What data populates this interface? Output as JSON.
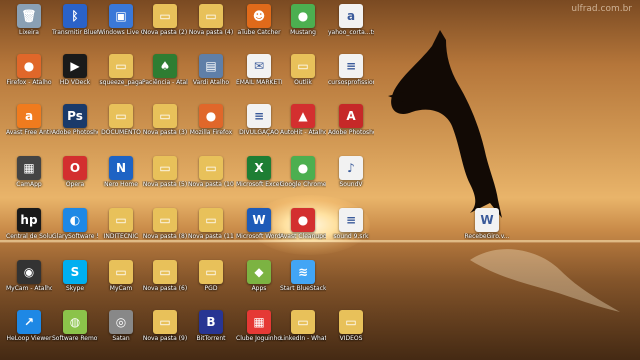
{
  "watermark": "ulfrad.com.br",
  "desktop_icons": [
    {
      "label": "Lixeira",
      "icon": "recycle-bin-icon",
      "color": "#8aa0b4",
      "glyph": "🗑"
    },
    {
      "label": "Transmitir Bluetooth",
      "icon": "bluetooth-icon",
      "color": "#2a62c8",
      "glyph": "ᛒ"
    },
    {
      "label": "Windows Live Galeria de Fotos",
      "icon": "photo-gallery-icon",
      "color": "#3a78d8",
      "glyph": "▣"
    },
    {
      "label": "Nova pasta (2)",
      "icon": "folder-icon",
      "color": "#e8c15a",
      "glyph": "▭"
    },
    {
      "label": "Nova pasta (4)",
      "icon": "folder-icon",
      "color": "#e8c15a",
      "glyph": "▭"
    },
    {
      "label": "aTube Catcher",
      "icon": "atube-icon",
      "color": "#e06a1a",
      "glyph": "☻"
    },
    {
      "label": "Mustang",
      "icon": "chrome-app-icon",
      "color": "#4caf50",
      "glyph": "●"
    },
    {
      "label": "yahoo_corta...ts Atalho",
      "icon": "document-icon",
      "color": "#f2f2f2",
      "glyph": "a"
    },
    {
      "label": "Firefox - Atalho",
      "icon": "firefox-icon",
      "color": "#e0672a",
      "glyph": "●"
    },
    {
      "label": "HD VDeck",
      "icon": "hd-vdeck-icon",
      "color": "#1a1a1a",
      "glyph": "▶"
    },
    {
      "label": "squeeze_paga",
      "icon": "folder-icon",
      "color": "#e8c15a",
      "glyph": "▭"
    },
    {
      "label": "Paciência - Atalho",
      "icon": "solitaire-icon",
      "color": "#2e7d32",
      "glyph": "♠"
    },
    {
      "label": "Vardi Atalho",
      "icon": "computer-icon",
      "color": "#5f7fa8",
      "glyph": "▤"
    },
    {
      "label": "EMAIL MARKETING",
      "icon": "document-icon",
      "color": "#f2f2f2",
      "glyph": "✉"
    },
    {
      "label": "Outlik",
      "icon": "folder-icon",
      "color": "#e8c15a",
      "glyph": "▭"
    },
    {
      "label": "cursosprofissionais (1) - Atalho",
      "icon": "document-icon",
      "color": "#f2f2f2",
      "glyph": "≡"
    },
    {
      "label": "Avast Free Antivirus",
      "icon": "avast-icon",
      "color": "#f07b1e",
      "glyph": "a"
    },
    {
      "label": "Adobe Photoshop ...",
      "icon": "photoshop-icon",
      "color": "#1a3a6a",
      "glyph": "Ps"
    },
    {
      "label": "DOCUMENTO",
      "icon": "folder-icon",
      "color": "#e8c15a",
      "glyph": "▭"
    },
    {
      "label": "Nova pasta (3)",
      "icon": "folder-icon",
      "color": "#e8c15a",
      "glyph": "▭"
    },
    {
      "label": "Mozilla Firefox",
      "icon": "firefox-icon",
      "color": "#e0672a",
      "glyph": "●"
    },
    {
      "label": "DIVULGAÇÃO",
      "icon": "document-icon",
      "color": "#f2f2f2",
      "glyph": "≡"
    },
    {
      "label": "AutoHit - Atalho",
      "icon": "autohit-icon",
      "color": "#d32f2f",
      "glyph": "▲"
    },
    {
      "label": "Adobe Photoshop CS5",
      "icon": "acrobat-icon",
      "color": "#c62828",
      "glyph": "A"
    },
    {
      "label": "CamApp",
      "icon": "camapp-icon",
      "color": "#444",
      "glyph": "▦"
    },
    {
      "label": "Opera",
      "icon": "opera-icon",
      "color": "#d32f2f",
      "glyph": "O"
    },
    {
      "label": "Nero Home",
      "icon": "nero-icon",
      "color": "#1e63c4",
      "glyph": "N"
    },
    {
      "label": "Nova pasta (5)",
      "icon": "folder-icon",
      "color": "#e8c15a",
      "glyph": "▭"
    },
    {
      "label": "Nova pasta (10)",
      "icon": "folder-icon",
      "color": "#e8c15a",
      "glyph": "▭"
    },
    {
      "label": "Microsoft Excel 2010",
      "icon": "excel-icon",
      "color": "#1e7e34",
      "glyph": "X"
    },
    {
      "label": "Google Chrome",
      "icon": "chrome-icon",
      "color": "#4caf50",
      "glyph": "●"
    },
    {
      "label": "SoundV",
      "icon": "audio-file-icon",
      "color": "#f2f2f2",
      "glyph": "♪"
    },
    {
      "label": "Central de Soluções HP",
      "icon": "hp-icon",
      "color": "#1a1a1a",
      "glyph": "hp"
    },
    {
      "label": "GlarySoftware 5",
      "icon": "glary-icon",
      "color": "#1e88e5",
      "glyph": "◐"
    },
    {
      "label": "INDITÉCNIC",
      "icon": "folder-icon",
      "color": "#e8c15a",
      "glyph": "▭"
    },
    {
      "label": "Nova pasta (8)",
      "icon": "folder-icon",
      "color": "#e8c15a",
      "glyph": "▭"
    },
    {
      "label": "Nova pasta (11)",
      "icon": "folder-icon",
      "color": "#e8c15a",
      "glyph": "▭"
    },
    {
      "label": "Microsoft Word 2010",
      "icon": "word-icon",
      "color": "#1e5bb8",
      "glyph": "W"
    },
    {
      "label": "Avast Cleanupdate",
      "icon": "cleanup-icon",
      "color": "#d32f2f",
      "glyph": "●"
    },
    {
      "label": "sound 9.srk",
      "icon": "document-icon",
      "color": "#f2f2f2",
      "glyph": "≡"
    },
    {
      "label": "RecebeGiro.v...",
      "icon": "word-doc-icon",
      "color": "#f2f2f2",
      "glyph": "W"
    },
    {
      "label": "MyCam - Atalho",
      "icon": "mycam-icon",
      "color": "#333",
      "glyph": "◉"
    },
    {
      "label": "Skype",
      "icon": "skype-icon",
      "color": "#00aff0",
      "glyph": "S"
    },
    {
      "label": "MyCam",
      "icon": "folder-icon",
      "color": "#e8c15a",
      "glyph": "▭"
    },
    {
      "label": "Nova pasta (6)",
      "icon": "folder-icon",
      "color": "#e8c15a",
      "glyph": "▭"
    },
    {
      "label": "PGD",
      "icon": "folder-icon",
      "color": "#e8c15a",
      "glyph": "▭"
    },
    {
      "label": "Apps",
      "icon": "android-icon",
      "color": "#7cb342",
      "glyph": "◆"
    },
    {
      "label": "Start BlueStacks",
      "icon": "bluestacks-icon",
      "color": "#42a5f5",
      "glyph": "≋"
    },
    {
      "label": "HeLoop Viewer",
      "icon": "viewer-icon",
      "color": "#1e88e5",
      "glyph": "↗"
    },
    {
      "label": "Software Remove Master v5.0.1.3",
      "icon": "remover-icon",
      "color": "#8bc34a",
      "glyph": "◍"
    },
    {
      "label": "Satan",
      "icon": "settings-icon",
      "color": "#888",
      "glyph": "◎"
    },
    {
      "label": "Nova pasta (9)",
      "icon": "folder-icon",
      "color": "#e8c15a",
      "glyph": "▭"
    },
    {
      "label": "BitTorrent",
      "icon": "bittorrent-icon",
      "color": "#283593",
      "glyph": "B"
    },
    {
      "label": "Clube Joguinhos",
      "icon": "games-icon",
      "color": "#e53935",
      "glyph": "▦"
    },
    {
      "label": "LinkedIn - WhatsApp ...",
      "icon": "folder-icon",
      "color": "#e8c15a",
      "glyph": "▭"
    },
    {
      "label": "VIDEOS",
      "icon": "folder-icon",
      "color": "#e8c15a",
      "glyph": "▭"
    }
  ]
}
